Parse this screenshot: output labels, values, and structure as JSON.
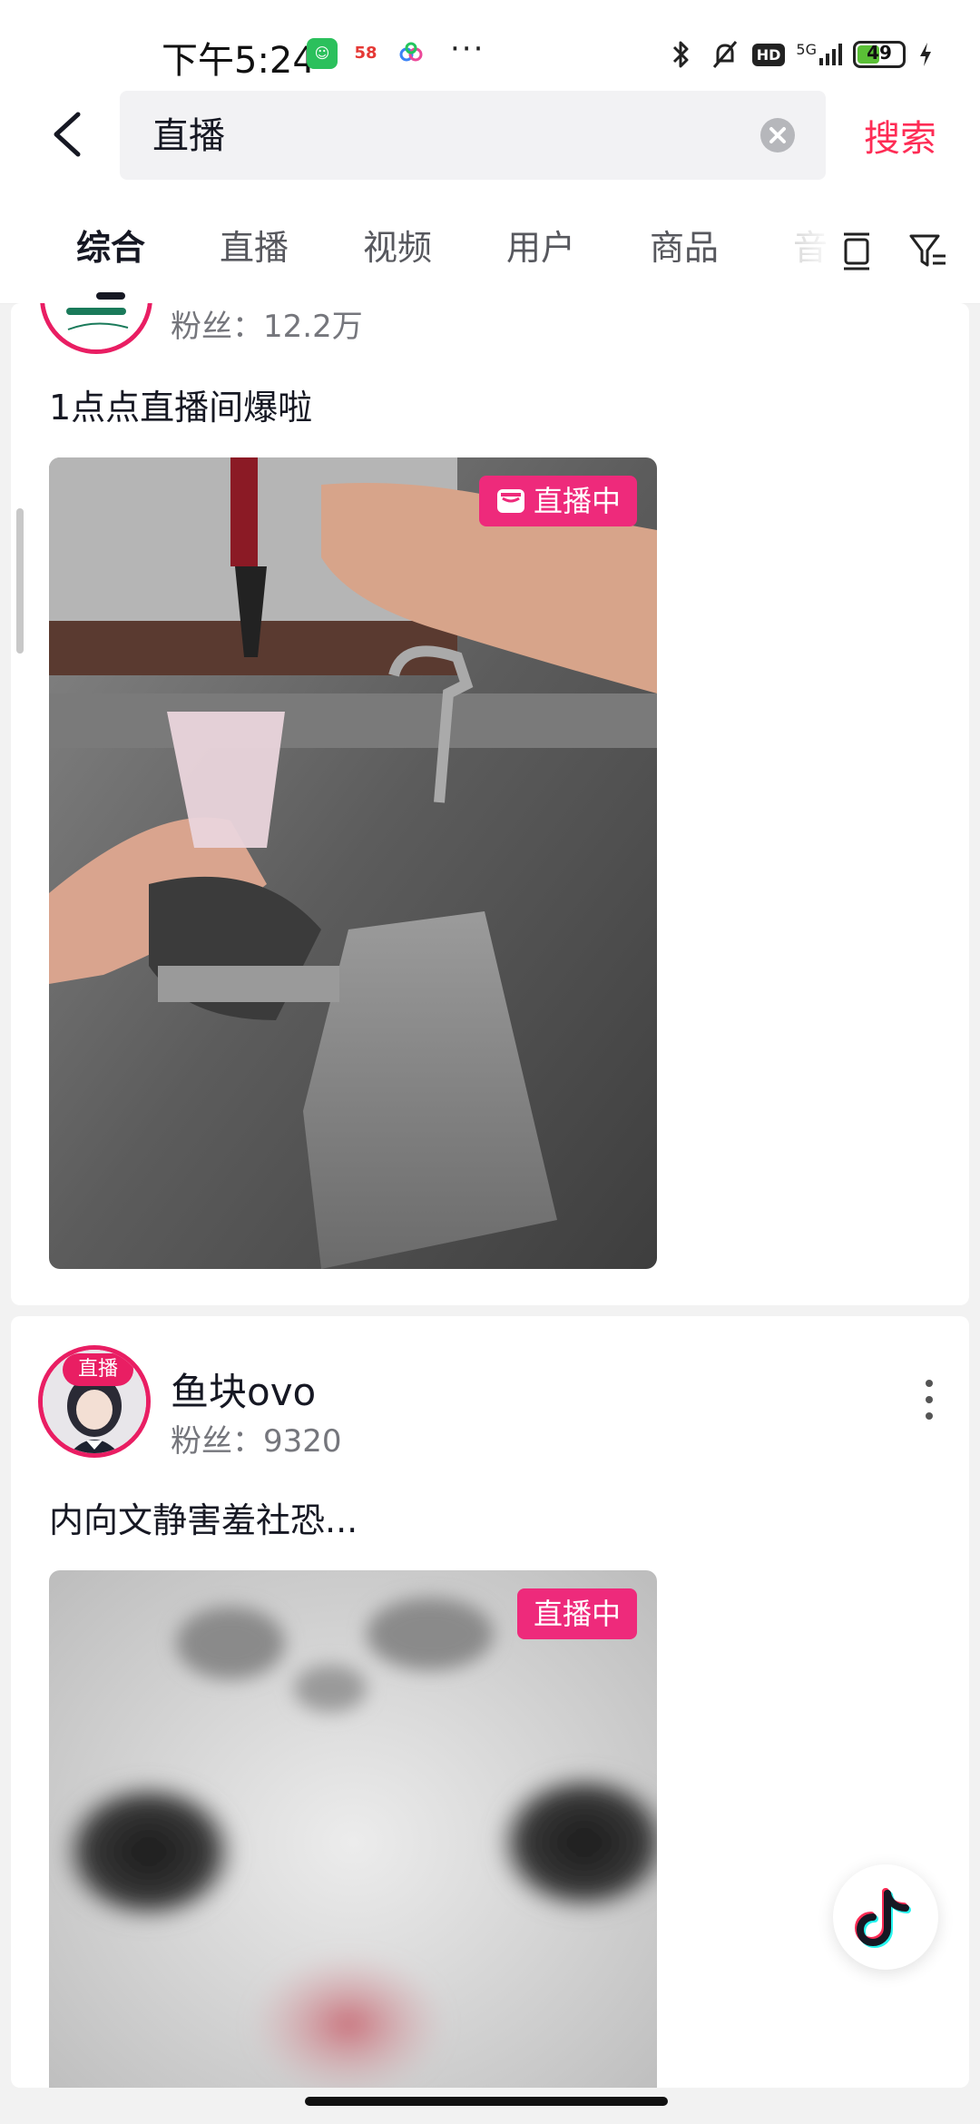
{
  "status_bar": {
    "time": "下午5:24",
    "apps": [
      "wechat-icon",
      "58-app-icon",
      "cloud-app-icon"
    ],
    "more": "···",
    "network": "5G",
    "hd": "HD",
    "battery": "49",
    "battery_level": 0.49
  },
  "search": {
    "query": "直播",
    "submit_label": "搜索"
  },
  "tabs": {
    "items": [
      "综合",
      "直播",
      "视频",
      "用户",
      "商品",
      "音"
    ],
    "active": "综合"
  },
  "cards": [
    {
      "fans": "粉丝：12.2万",
      "description": "1点点直播间爆啦",
      "live_badge": "直播中"
    },
    {
      "avatar_badge": "直播",
      "username": "鱼块ovo",
      "fans": "粉丝：9320",
      "description": "内向文静害羞社恐...",
      "live_badge": "直播中"
    }
  ],
  "colors": {
    "accent": "#fe2c55",
    "live_pink": "#ee2a7b",
    "battery_green": "#5ac036"
  }
}
